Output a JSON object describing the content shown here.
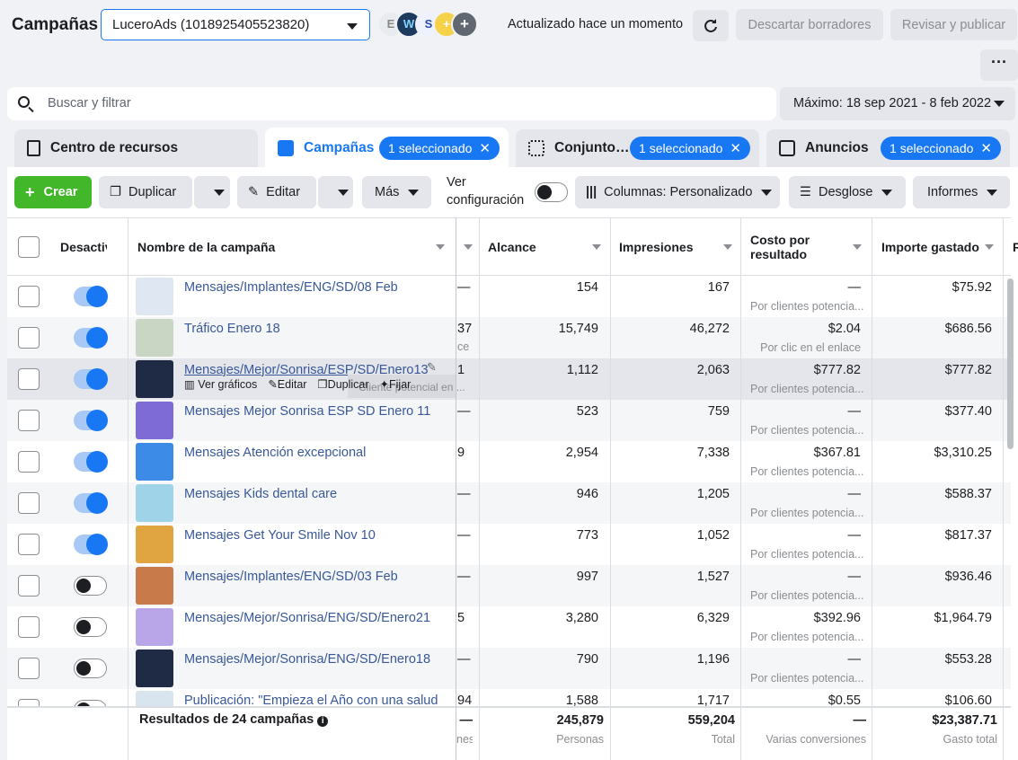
{
  "header": {
    "title": "Campañas",
    "account": "LuceroAds (1018925405523820)",
    "avatars": [
      "E",
      "W",
      "S",
      "+"
    ],
    "status": "Actualizado hace un momento",
    "discard_label": "Descartar borradores",
    "publish_label": "Revisar y publicar",
    "more_label": "···"
  },
  "search": {
    "placeholder": "Buscar y filtrar",
    "date_range": "Máximo: 18 sep 2021 - 8 feb 2022"
  },
  "tabs": [
    {
      "label": "Centro de recursos",
      "pill": ""
    },
    {
      "label": "Campañas",
      "pill": "1 seleccionado"
    },
    {
      "label": "Conjunto…",
      "pill": "1 seleccionado"
    },
    {
      "label": "Anuncios",
      "pill": "1 seleccionado"
    }
  ],
  "toolbar": {
    "create": "Crear",
    "duplicate": "Duplicar",
    "edit": "Editar",
    "more": "Más",
    "view_config": "Ver configuración",
    "columns": "Columnas: Personalizado",
    "breakdown": "Desglose",
    "reports": "Informes"
  },
  "columns": {
    "toggle": "Desactiv",
    "name": "Nombre de la campaña",
    "reach": "Alcance",
    "impressions": "Impresiones",
    "cost": "Costo por resultado",
    "spent": "Importe gastado",
    "extra": "R"
  },
  "hover_actions": {
    "charts": "Ver gráficos",
    "edit": "Editar",
    "duplicate": "Duplicar",
    "pin": "Fijar",
    "overlay_text": "Cliente potencial en ..."
  },
  "rows": [
    {
      "name": "Mensajes/Implantes/ENG/SD/08 Feb",
      "on": true,
      "hidden_val": "—",
      "hidden_sub": "",
      "reach": "154",
      "impressions": "167",
      "cost": "—",
      "cost_sub": "Por clientes potencia...",
      "spent": "$75.92",
      "thumb": "#dfe7f2"
    },
    {
      "name": "Tráfico Enero 18",
      "on": true,
      "hidden_val": "37",
      "hidden_sub": "ce",
      "reach": "15,749",
      "impressions": "46,272",
      "cost": "$2.04",
      "cost_sub": "Por clic en el enlace",
      "spent": "$686.56",
      "thumb": "#c9d6c3"
    },
    {
      "name": "Mensajes/Mejor/Sonrisa/ESP/SD/Enero13",
      "on": true,
      "hidden_val": "1",
      "hidden_sub": "",
      "reach": "1,112",
      "impressions": "2,063",
      "cost": "$777.82",
      "cost_sub": "Por clientes potencia...",
      "spent": "$777.82",
      "thumb": "#1f2a44"
    },
    {
      "name": "Mensajes Mejor Sonrisa ESP SD Enero 11",
      "on": true,
      "hidden_val": "—",
      "hidden_sub": "",
      "reach": "523",
      "impressions": "759",
      "cost": "—",
      "cost_sub": "Por clientes potencia...",
      "spent": "$377.40",
      "thumb": "#7e6bd6"
    },
    {
      "name": "Mensajes Atención excepcional",
      "on": true,
      "hidden_val": "9",
      "hidden_sub": "",
      "reach": "2,954",
      "impressions": "7,338",
      "cost": "$367.81",
      "cost_sub": "Por clientes potencia...",
      "spent": "$3,310.25",
      "thumb": "#3c8ce7"
    },
    {
      "name": "Mensajes Kids dental care",
      "on": true,
      "hidden_val": "—",
      "hidden_sub": "",
      "reach": "946",
      "impressions": "1,205",
      "cost": "—",
      "cost_sub": "Por clientes potencia...",
      "spent": "$588.37",
      "thumb": "#9fd3e8"
    },
    {
      "name": "Mensajes Get Your Smile Nov 10",
      "on": true,
      "hidden_val": "—",
      "hidden_sub": "",
      "reach": "773",
      "impressions": "1,052",
      "cost": "—",
      "cost_sub": "Por clientes potencia...",
      "spent": "$817.37",
      "thumb": "#e0a540"
    },
    {
      "name": "Mensajes/Implantes/ENG/SD/03 Feb",
      "on": false,
      "hidden_val": "—",
      "hidden_sub": "",
      "reach": "997",
      "impressions": "1,527",
      "cost": "—",
      "cost_sub": "Por clientes potencia...",
      "spent": "$936.46",
      "thumb": "#c97a4a"
    },
    {
      "name": "Mensajes/Mejor/Sonrisa/ENG/SD/Enero21",
      "on": false,
      "hidden_val": "5",
      "hidden_sub": "",
      "reach": "3,280",
      "impressions": "6,329",
      "cost": "$392.96",
      "cost_sub": "Por clientes potencia...",
      "spent": "$1,964.79",
      "thumb": "#b9a6e8"
    },
    {
      "name": "Mensajes/Mejor/Sonrisa/ENG/SD/Enero18",
      "on": false,
      "hidden_val": "—",
      "hidden_sub": "",
      "reach": "790",
      "impressions": "1,196",
      "cost": "—",
      "cost_sub": "Por clientes potencia...",
      "spent": "$553.28",
      "thumb": "#1f2a44"
    },
    {
      "name": "Publicación: \"Empieza el Año con una salud ...",
      "on": false,
      "hidden_val": "94",
      "hidden_sub": "",
      "reach": "1,588",
      "impressions": "1,717",
      "cost": "$0.55",
      "cost_sub": "",
      "spent": "$106.60",
      "thumb": "#d8e4ee"
    }
  ],
  "footer": {
    "label": "Resultados de 24 campañas",
    "hidden_val": "—",
    "hidden_sub": "nes",
    "reach": "245,879",
    "reach_sub": "Personas",
    "impressions": "559,204",
    "impressions_sub": "Total",
    "cost": "—",
    "cost_sub": "Varias conversiones",
    "spent": "$23,387.71",
    "spent_sub": "Gasto total"
  }
}
